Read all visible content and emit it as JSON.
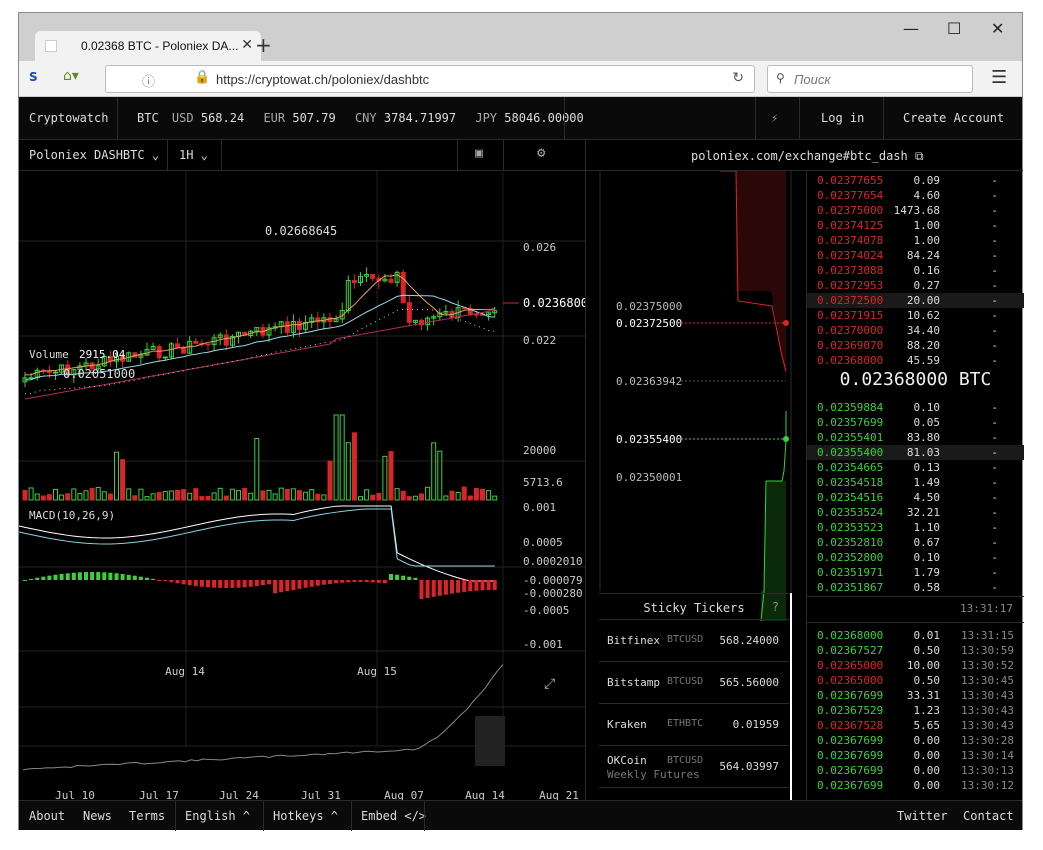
{
  "browser": {
    "tab_title": "0.02368 BTC - Poloniex DA...",
    "url": "https://cryptowat.ch/poloniex/dashbtc",
    "search_placeholder": "Поиск"
  },
  "topbar": {
    "brand": "Cryptowatch",
    "prices": [
      {
        "cur": "BTC",
        "hidden": true
      },
      {
        "cur": "USD",
        "val": "568.24"
      },
      {
        "cur": "EUR",
        "val": "507.79"
      },
      {
        "cur": "CNY",
        "val": "3784.71997"
      },
      {
        "cur": "JPY",
        "val": "58046.00000"
      }
    ],
    "btc_label": "BTC",
    "login": "Log in",
    "create_account": "Create Account"
  },
  "chart": {
    "pair": "Poloniex DASHBTC",
    "timeframe": "1H",
    "high_label": "0.02668645",
    "low_label": "0.02051000",
    "price_ticks": [
      "0.026",
      "0.022"
    ],
    "current_price": "0.0236800",
    "volume_label": "Volume",
    "volume_value": "2915.04",
    "volume_ticks": [
      "20000"
    ],
    "volume_current": "5713.6",
    "macd_label": "MACD(10,26,9)",
    "macd_ticks": [
      "0.001",
      "0.0005",
      "0.0002010",
      "-0.000079",
      "-0.000280",
      "-0.0005",
      "-0.001"
    ],
    "x_labels": [
      "Aug 14",
      "Aug 15"
    ],
    "overview_labels": [
      "Jul 10",
      "Jul 17",
      "Jul 24",
      "Jul 31",
      "Aug 07",
      "Aug 14",
      "Aug 21"
    ]
  },
  "depth": {
    "link": "poloniex.com/exchange#btc_dash",
    "labels": [
      "0.02375000",
      "0.02372500",
      "0.02363942",
      "0.02355400",
      "0.02350001"
    ]
  },
  "orderbook": {
    "asks": [
      {
        "p": "0.02377655",
        "a": "0.09",
        "d": "-"
      },
      {
        "p": "0.02377654",
        "a": "4.60",
        "d": "-"
      },
      {
        "p": "0.02375000",
        "a": "1473.68",
        "d": "-"
      },
      {
        "p": "0.02374125",
        "a": "1.00",
        "d": "-"
      },
      {
        "p": "0.02374078",
        "a": "1.00",
        "d": "-"
      },
      {
        "p": "0.02374024",
        "a": "84.24",
        "d": "-"
      },
      {
        "p": "0.02373088",
        "a": "0.16",
        "d": "-"
      },
      {
        "p": "0.02372953",
        "a": "0.27",
        "d": "-"
      },
      {
        "p": "0.02372500",
        "a": "20.00",
        "d": "-"
      },
      {
        "p": "0.02371915",
        "a": "10.62",
        "d": "-"
      },
      {
        "p": "0.02370000",
        "a": "34.40",
        "d": "-"
      },
      {
        "p": "0.02369070",
        "a": "88.20",
        "d": "-"
      },
      {
        "p": "0.02368000",
        "a": "45.59",
        "d": "-"
      }
    ],
    "last_price": "0.02368000 BTC",
    "bids": [
      {
        "p": "0.02359884",
        "a": "0.10",
        "d": "-"
      },
      {
        "p": "0.02357699",
        "a": "0.05",
        "d": "-"
      },
      {
        "p": "0.02355401",
        "a": "83.80",
        "d": "-"
      },
      {
        "p": "0.02355400",
        "a": "81.03",
        "d": "-"
      },
      {
        "p": "0.02354665",
        "a": "0.13",
        "d": "-"
      },
      {
        "p": "0.02354518",
        "a": "1.49",
        "d": "-"
      },
      {
        "p": "0.02354516",
        "a": "4.50",
        "d": "-"
      },
      {
        "p": "0.02353524",
        "a": "32.21",
        "d": "-"
      },
      {
        "p": "0.02353523",
        "a": "1.10",
        "d": "-"
      },
      {
        "p": "0.02352810",
        "a": "0.67",
        "d": "-"
      },
      {
        "p": "0.02352800",
        "a": "0.10",
        "d": "-"
      },
      {
        "p": "0.02351971",
        "a": "1.79",
        "d": "-"
      },
      {
        "p": "0.02351867",
        "a": "0.58",
        "d": "-"
      }
    ],
    "time": "13:31:17",
    "trades": [
      {
        "p": "0.02368000",
        "a": "0.01",
        "t": "13:31:15",
        "c": "grn"
      },
      {
        "p": "0.02367527",
        "a": "0.50",
        "t": "13:30:59",
        "c": "grn"
      },
      {
        "p": "0.02365000",
        "a": "10.00",
        "t": "13:30:52",
        "c": "red"
      },
      {
        "p": "0.02365000",
        "a": "0.50",
        "t": "13:30:45",
        "c": "red"
      },
      {
        "p": "0.02367699",
        "a": "33.31",
        "t": "13:30:43",
        "c": "grn"
      },
      {
        "p": "0.02367529",
        "a": "1.23",
        "t": "13:30:43",
        "c": "grn"
      },
      {
        "p": "0.02367528",
        "a": "5.65",
        "t": "13:30:43",
        "c": "red"
      },
      {
        "p": "0.02367699",
        "a": "0.00",
        "t": "13:30:28",
        "c": "grn"
      },
      {
        "p": "0.02367699",
        "a": "0.00",
        "t": "13:30:14",
        "c": "grn"
      },
      {
        "p": "0.02367699",
        "a": "0.00",
        "t": "13:30:13",
        "c": "grn"
      },
      {
        "p": "0.02367699",
        "a": "0.00",
        "t": "13:30:12",
        "c": "grn"
      }
    ]
  },
  "sticky": {
    "title": "Sticky Tickers",
    "help": "?",
    "tickers": [
      {
        "ex": "Bitfinex",
        "pair": "BTCUSD",
        "val": "568.24000"
      },
      {
        "ex": "Bitstamp",
        "pair": "BTCUSD",
        "val": "565.56000"
      },
      {
        "ex": "Kraken",
        "pair": "ETHBTC",
        "val": "0.01959"
      },
      {
        "ex": "OKCoin",
        "pair": "BTCUSD",
        "sub": "Weekly Futures",
        "val": "564.03997"
      }
    ]
  },
  "footer": {
    "about": "About",
    "news": "News",
    "terms": "Terms",
    "lang": "English ^",
    "hotkeys": "Hotkeys ^",
    "embed": "Embed </>",
    "twitter": "Twitter",
    "contact": "Contact"
  },
  "colors": {
    "up": "#3cd03c",
    "down": "#d9252a",
    "bg": "#000000",
    "text": "#dddddd"
  }
}
